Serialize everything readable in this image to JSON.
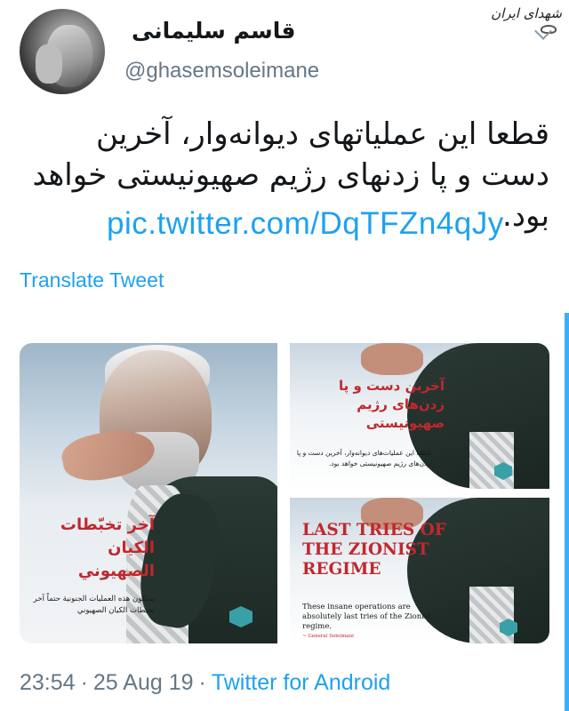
{
  "watermark": {
    "text": "شهدای ایران"
  },
  "user": {
    "display_name": "قاسم سلیمانی",
    "handle": "@ghasemsoleimane"
  },
  "tweet": {
    "text": "قطعا این عملیاتهای دیوانه‌وار، آخرین دست و پا زدنهای رژیم صهیونیستی خواهد بود.",
    "link": "pic.twitter.com/DqTFZn4qJy",
    "translate_label": "Translate Tweet"
  },
  "media": {
    "big": {
      "title": "آخر تخبّطات الكيان الصهيوني",
      "subtitle": "ستكون هذه العمليات الجنونية حتماً آخر تخبطات الكيان الصهيوني"
    },
    "top_right": {
      "title": "آخرین دست و پا زدن‌های رژیم صهیونیستی",
      "subtitle": "قطعا این عملیات‌های دیوانه‌وار، آخرین دست و پا زدن‌های رژیم صهیونیستی خواهد بود."
    },
    "bottom_right": {
      "title": "LAST TRIES OF THE ZIONIST REGIME",
      "subtitle": "These insane operations are absolutely last tries of the Zionist regime.",
      "signature": "~ General Soleimani"
    }
  },
  "footer": {
    "time": "23:54",
    "date": "25 Aug 19",
    "source": "Twitter for Android"
  },
  "colors": {
    "link": "#1da1f2",
    "muted": "#657786",
    "poster_red": "#c0282d"
  }
}
